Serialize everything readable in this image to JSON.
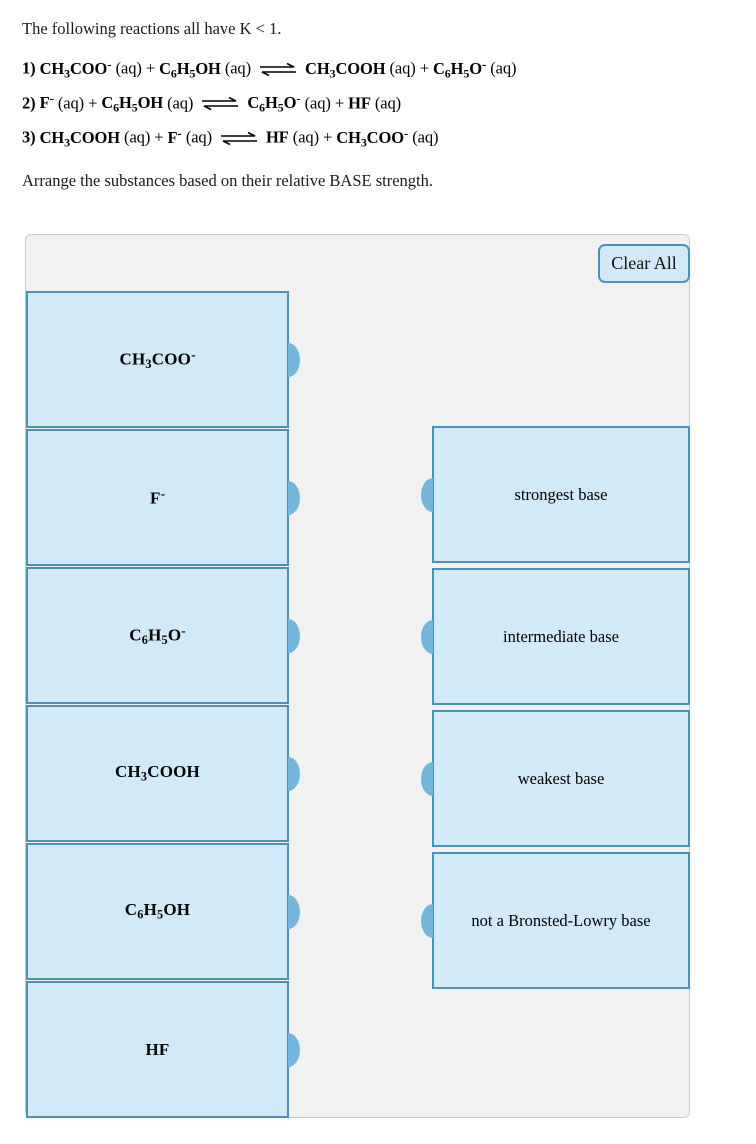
{
  "prompt": {
    "intro": "The following reactions all have K < 1.",
    "instruction": "Arrange the substances based on their relative BASE strength.",
    "equations": [
      {
        "number": "1)",
        "left": [
          {
            "formula": "CH3COO-",
            "phase": "(aq)"
          },
          {
            "formula": "C6H5OH",
            "phase": "(aq)"
          }
        ],
        "right": [
          {
            "formula": "CH3COOH",
            "phase": "(aq)"
          },
          {
            "formula": "C6H5O-",
            "phase": "(aq)"
          }
        ]
      },
      {
        "number": "2)",
        "left": [
          {
            "formula": "F-",
            "phase": "(aq)"
          },
          {
            "formula": "C6H5OH",
            "phase": "(aq)"
          }
        ],
        "right": [
          {
            "formula": "C6H5O-",
            "phase": "(aq)"
          },
          {
            "formula": "HF",
            "phase": "(aq)"
          }
        ]
      },
      {
        "number": "3)",
        "left": [
          {
            "formula": "CH3COOH",
            "phase": "(aq)"
          },
          {
            "formula": "F-",
            "phase": "(aq)"
          }
        ],
        "right": [
          {
            "formula": "HF",
            "phase": "(aq)"
          },
          {
            "formula": "CH3COO-",
            "phase": "(aq)"
          }
        ]
      }
    ],
    "plus_sign": "+",
    "arrow_icon": "equilibrium-arrow"
  },
  "panel": {
    "clear_all_label": "Clear All",
    "source_tiles": [
      {
        "label": "CH3COO-"
      },
      {
        "label": "F-"
      },
      {
        "label": "C6H5O-"
      },
      {
        "label": "CH3COOH"
      },
      {
        "label": "C6H5OH"
      },
      {
        "label": "HF"
      }
    ],
    "target_tiles": [
      {
        "label": "strongest base"
      },
      {
        "label": "intermediate base"
      },
      {
        "label": "weakest base"
      },
      {
        "label": "not a Bronsted-Lowry base"
      }
    ]
  },
  "colors": {
    "tile_fill": "#d2e9f7",
    "tile_border": "#4b91b5",
    "connector": "#74b5da",
    "panel_bg": "#f1f1f1",
    "panel_border": "#c3ccd6"
  }
}
